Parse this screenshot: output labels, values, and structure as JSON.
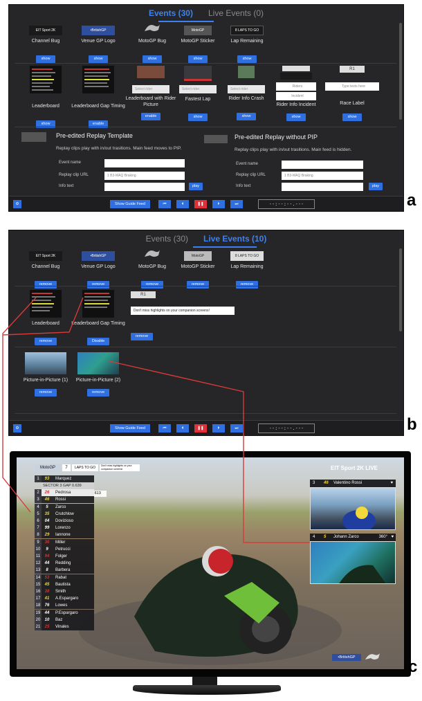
{
  "panel_a": {
    "tabs": [
      {
        "label": "Events (30)",
        "active": true
      },
      {
        "label": "Live Events (0)",
        "active": false
      }
    ],
    "row1": [
      {
        "thumb": "EIT Sport 2K",
        "label": "Channel Bug",
        "button": "show"
      },
      {
        "thumb": "•BritishGP",
        "label": "Venue GP Logo",
        "button": "show"
      },
      {
        "thumb": "MotoGP",
        "label": "MotoGP Bug",
        "button": "show"
      },
      {
        "thumb": "MotoGP",
        "label": "MotoGP Sticker",
        "button": "show"
      },
      {
        "thumb": "8 LAPS TO GO",
        "label": "Lap Remaining",
        "button": "show"
      }
    ],
    "row2": [
      {
        "label": "Leaderboard",
        "button": "show"
      },
      {
        "label": "Leaderboard Gap Timing",
        "button": "enable"
      },
      {
        "label": "Leaderboard with Rider Picture",
        "select": "Select rider",
        "button": "enable"
      },
      {
        "label": "Fastest Lap",
        "select": "Select rider",
        "button": "show"
      },
      {
        "label": "Rider Info Crash",
        "select": "Select rider",
        "button": "show"
      },
      {
        "label": "Rider Info Incident",
        "field1": "Riders",
        "field2": "Incident",
        "button": "show"
      },
      {
        "label": "Race Label",
        "tag": "R1",
        "field1": "Type texts here",
        "button": "show"
      }
    ],
    "replay_left": {
      "title": "Pre-edited Replay Template",
      "desc": "Replay clips play with in/out trasitions. Main feed moves to PIP.",
      "fields": [
        {
          "label": "Event name",
          "value": ""
        },
        {
          "label": "Replay clip URL",
          "value": "1 B3-MAQ Braking"
        },
        {
          "label": "Info text",
          "value": ""
        }
      ],
      "button": "play"
    },
    "replay_right": {
      "title": "Pre-edited Replay without PIP",
      "desc": "Replay clips play with in/out trasitions. Main feed is hidden.",
      "fields": [
        {
          "label": "Event name",
          "value": ""
        },
        {
          "label": "Replay clip URL",
          "value": "1 B3-MAQ Braking"
        },
        {
          "label": "Info text",
          "value": ""
        }
      ],
      "button": "play"
    },
    "toolbar": {
      "guide": "Show Guide Feed",
      "timecode": "--:--:--.---"
    }
  },
  "panel_b": {
    "tabs": [
      {
        "label": "Events (30)",
        "active": false
      },
      {
        "label": "Live Events (10)",
        "active": true
      }
    ],
    "row1": [
      {
        "thumb": "EIT Sport 2K",
        "label": "Channel Bug",
        "button": "remove"
      },
      {
        "thumb": "•BritishGP",
        "label": "Venue GP Logo",
        "button": "remove"
      },
      {
        "thumb": "MotoGP",
        "label": "MotoGP Bug",
        "button": "remove"
      },
      {
        "thumb": "MotoGP",
        "label": "MotoGP Sticker",
        "button": "remove"
      },
      {
        "thumb": "8 LAPS TO GO",
        "label": "Lap Remaining",
        "button": "remove"
      }
    ],
    "row2": [
      {
        "label": "Leaderboard",
        "button": "remove"
      },
      {
        "label": "Leaderboard Gap Timing",
        "button": "Disable"
      },
      {
        "label": "",
        "tag": "R1",
        "field1": "Don't miss highlights on your companion screens!",
        "button": "remove"
      }
    ],
    "row3": [
      {
        "label": "Picture-in-Picture (1)",
        "button": "remove"
      },
      {
        "label": "Picture-in-Picture (2)",
        "button": "remove"
      }
    ],
    "toolbar": {
      "guide": "Show Guide Feed",
      "timecode": "--:--:--.---"
    }
  },
  "tv": {
    "top_bar": {
      "motogp": "MotoGP",
      "laps": "7",
      "laps_label": "LAPS TO GO",
      "msg": "Don't miss highlights on your companion screens!"
    },
    "channel": "EIT Sport 2K LIVE",
    "sector": "SECTOR 3 GAP 0.639",
    "gap": "0.613",
    "leaderboard": [
      {
        "pos": "1",
        "num": "93",
        "name": "Marquez"
      },
      {
        "pos": "2",
        "num": "26",
        "name": "Pedrosa"
      },
      {
        "pos": "3",
        "num": "46",
        "name": "Rossi"
      },
      {
        "pos": "4",
        "num": "5",
        "name": "Zarco"
      },
      {
        "pos": "5",
        "num": "35",
        "name": "Crutchlow"
      },
      {
        "pos": "6",
        "num": "04",
        "name": "Dovizioso"
      },
      {
        "pos": "7",
        "num": "99",
        "name": "Lorenzo"
      },
      {
        "pos": "8",
        "num": "29",
        "name": "Iannone"
      },
      {
        "pos": "9",
        "num": "36",
        "name": "Miller"
      },
      {
        "pos": "10",
        "num": "9",
        "name": "Petrucci"
      },
      {
        "pos": "11",
        "num": "94",
        "name": "Folger"
      },
      {
        "pos": "12",
        "num": "44",
        "name": "Redding"
      },
      {
        "pos": "13",
        "num": "8",
        "name": "Barbera"
      },
      {
        "pos": "14",
        "num": "53",
        "name": "Rabat"
      },
      {
        "pos": "15",
        "num": "45",
        "name": "Bautista"
      },
      {
        "pos": "16",
        "num": "38",
        "name": "Smith"
      },
      {
        "pos": "17",
        "num": "41",
        "name": "A.Espargaro"
      },
      {
        "pos": "18",
        "num": "76",
        "name": "Lowes"
      },
      {
        "pos": "19",
        "num": "44",
        "name": "P.Espargaro"
      },
      {
        "pos": "20",
        "num": "10",
        "name": "Baz"
      },
      {
        "pos": "21",
        "num": "25",
        "name": "Vinales"
      }
    ],
    "pip1": {
      "pos": "3",
      "num": "46",
      "name": "Valentino Rossi"
    },
    "pip2": {
      "pos": "4",
      "num": "5",
      "name": "Johann Zarco",
      "tag": "360°"
    },
    "venue": "•BritishGP"
  },
  "letters": {
    "a": "a",
    "b": "b",
    "c": "c"
  },
  "colors": {
    "accent": "#2f6fe0",
    "stop": "#e0303a",
    "panel": "#262628",
    "connector": "#d83a3a"
  }
}
